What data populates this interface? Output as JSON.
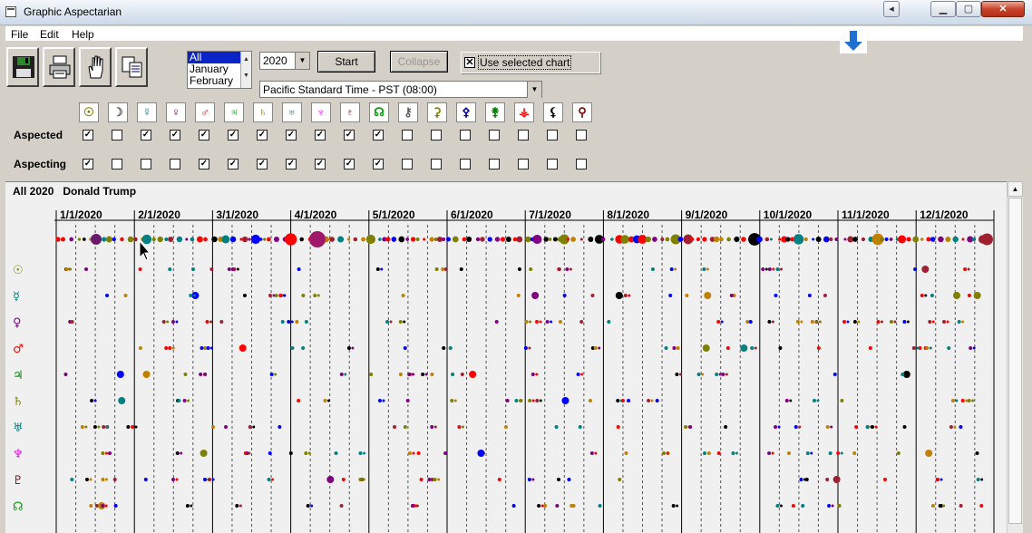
{
  "window": {
    "title": "Graphic Aspectarian"
  },
  "menu": [
    "File",
    "Edit",
    "Help"
  ],
  "toolbar": {
    "icons": [
      "save-icon",
      "print-icon",
      "hand-icon",
      "copy-icon"
    ]
  },
  "months_list": {
    "options": [
      "All",
      "January",
      "February"
    ],
    "selected": "All"
  },
  "year_select": {
    "value": "2020"
  },
  "start_button": "Start",
  "collapse_button": "Collapse",
  "use_selected_chart": {
    "label": "Use selected chart",
    "checked": true
  },
  "timezone_select": {
    "value": "Pacific Standard Time - PST (08:00)"
  },
  "planets": [
    {
      "glyph": "☉",
      "color": "#808000",
      "aspected": true,
      "aspecting": true
    },
    {
      "glyph": "☽",
      "color": "#606060",
      "aspected": false,
      "aspecting": false
    },
    {
      "glyph": "☿",
      "color": "#008080",
      "aspected": true,
      "aspecting": false
    },
    {
      "glyph": "♀",
      "color": "#800080",
      "aspected": true,
      "aspecting": false
    },
    {
      "glyph": "♂",
      "color": "#ff0000",
      "aspected": true,
      "aspecting": true
    },
    {
      "glyph": "♃",
      "color": "#008000",
      "aspected": true,
      "aspecting": true
    },
    {
      "glyph": "♄",
      "color": "#808000",
      "aspected": true,
      "aspecting": true
    },
    {
      "glyph": "♅",
      "color": "#008080",
      "aspected": true,
      "aspecting": true
    },
    {
      "glyph": "♆",
      "color": "#ff00ff",
      "aspected": true,
      "aspecting": true
    },
    {
      "glyph": "♇",
      "color": "#800000",
      "aspected": true,
      "aspecting": true
    },
    {
      "glyph": "☊",
      "color": "#00a000",
      "aspected": true,
      "aspecting": true
    },
    {
      "glyph": "⚷",
      "color": "#606060",
      "aspected": false,
      "aspecting": false
    },
    {
      "glyph": "⚳",
      "color": "#808000",
      "aspected": false,
      "aspecting": false
    },
    {
      "glyph": "⚴",
      "color": "#0000a0",
      "aspected": false,
      "aspecting": false
    },
    {
      "glyph": "⚵",
      "color": "#008000",
      "aspected": false,
      "aspecting": false
    },
    {
      "glyph": "⚶",
      "color": "#ff0000",
      "aspected": false,
      "aspecting": false
    },
    {
      "glyph": "⚸",
      "color": "#000000",
      "aspected": false,
      "aspecting": false
    },
    {
      "glyph": "⚲",
      "color": "#800000",
      "aspected": false,
      "aspecting": false
    }
  ],
  "row_labels": {
    "aspected": "Aspected",
    "aspecting": "Aspecting"
  },
  "chart": {
    "period": "All 2020",
    "person": "Donald Trump"
  },
  "chart_data": {
    "type": "scatter",
    "months": [
      "1/1/2020",
      "2/1/2020",
      "3/1/2020",
      "4/1/2020",
      "5/1/2020",
      "6/1/2020",
      "7/1/2020",
      "8/1/2020",
      "9/1/2020",
      "10/1/2020",
      "11/1/2020",
      "12/1/2020"
    ],
    "rows": [
      {
        "glyph": "☉",
        "color": "#808000"
      },
      {
        "glyph": "☿",
        "color": "#008080"
      },
      {
        "glyph": "♀",
        "color": "#800080"
      },
      {
        "glyph": "♂",
        "color": "#ff0000"
      },
      {
        "glyph": "♃",
        "color": "#008000"
      },
      {
        "glyph": "♄",
        "color": "#808000"
      },
      {
        "glyph": "♅",
        "color": "#008080"
      },
      {
        "glyph": "♆",
        "color": "#ff00ff"
      },
      {
        "glyph": "♇",
        "color": "#800000"
      },
      {
        "glyph": "☊",
        "color": "#00a000"
      }
    ]
  }
}
